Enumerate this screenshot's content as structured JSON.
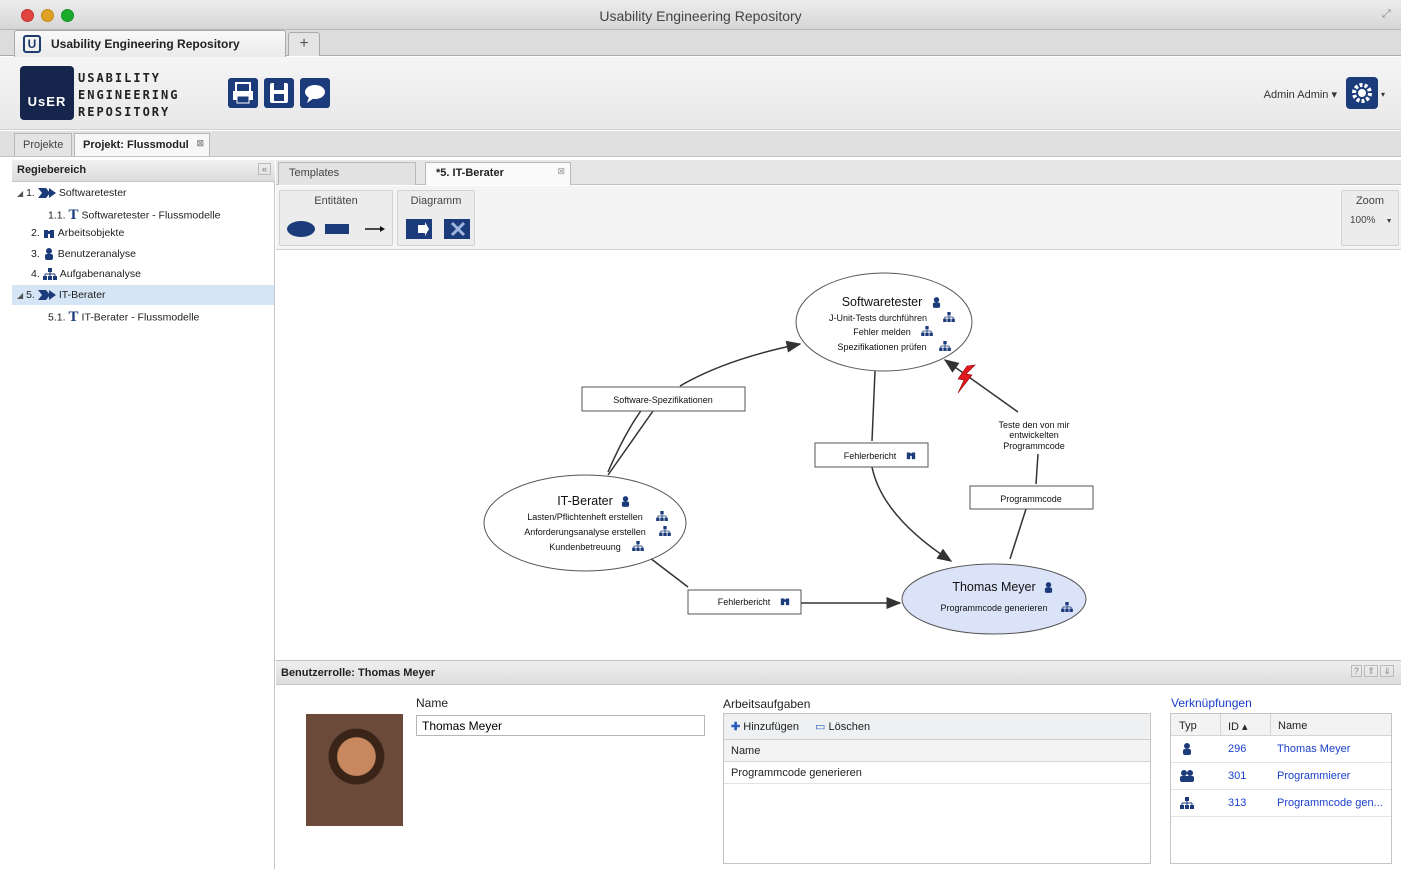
{
  "window": {
    "title": "Usability Engineering Repository"
  },
  "browser_tab": {
    "label": "Usability Engineering Repository",
    "new_tab": "+"
  },
  "logo": {
    "badge": "UsER",
    "line1": "USABILITY",
    "line2": "ENGINEERING",
    "line3": "REPOSITORY"
  },
  "user": {
    "name": "Admin Admin ▾"
  },
  "project_tabs": [
    {
      "label": "Projekte"
    },
    {
      "label": "Projekt: Flussmodul"
    }
  ],
  "sidebar": {
    "title": "Regiebereich",
    "items": [
      {
        "num": "1.",
        "label": "Softwaretester"
      },
      {
        "num": "1.1.",
        "label": "Softwaretester - Flussmodelle"
      },
      {
        "num": "2.",
        "label": "Arbeitsobjekte"
      },
      {
        "num": "3.",
        "label": "Benutzeranalyse"
      },
      {
        "num": "4.",
        "label": "Aufgabenanalyse"
      },
      {
        "num": "5.",
        "label": "IT-Berater"
      },
      {
        "num": "5.1.",
        "label": "IT-Berater - Flussmodelle"
      }
    ]
  },
  "editor_tabs": [
    {
      "label": "Templates"
    },
    {
      "label": "*5. IT-Berater"
    }
  ],
  "palette": {
    "entities": "Entitäten",
    "diagram": "Diagramm",
    "zoom_label": "Zoom",
    "zoom_value": "100%"
  },
  "diagram": {
    "nodes": {
      "softwaretester": {
        "title": "Softwaretester",
        "tasks": [
          "J-Unit-Tests durchführen",
          "Fehler melden",
          "Spezifikationen prüfen"
        ]
      },
      "itberater": {
        "title": "IT-Berater",
        "tasks": [
          "Lasten/Pflichtenheft erstellen",
          "Anforderungsanalyse erstellen",
          "Kundenbetreuung"
        ]
      },
      "thomas": {
        "title": "Thomas Meyer",
        "tasks": [
          "Programmcode generieren"
        ]
      }
    },
    "flows": {
      "spec": "Software-Spezifikationen",
      "fehler1": "Fehlerbericht",
      "fehler2": "Fehlerbericht",
      "programmcode": "Programmcode",
      "note_line1": "Teste den von mir",
      "note_line2": "entwickelten",
      "note_line3": "Programmcode"
    }
  },
  "properties": {
    "title": "Benutzerrolle: Thomas Meyer",
    "name_label": "Name",
    "name_value": "Thomas Meyer",
    "tasks_label": "Arbeitsaufgaben",
    "add": "Hinzufügen",
    "delete": "Löschen",
    "tasks_col": "Name",
    "tasks": [
      "Programmcode generieren"
    ],
    "links_label": "Verknüpfungen",
    "links_cols": {
      "typ": "Typ",
      "id": "ID ▴",
      "name": "Name"
    },
    "links": [
      {
        "id": "296",
        "name": "Thomas Meyer"
      },
      {
        "id": "301",
        "name": "Programmierer"
      },
      {
        "id": "313",
        "name": "Programmcode gen..."
      }
    ]
  }
}
